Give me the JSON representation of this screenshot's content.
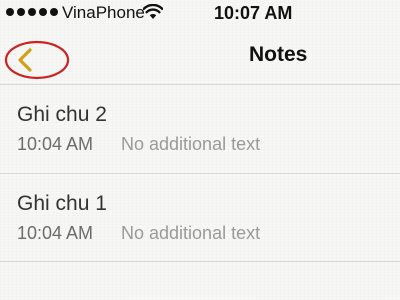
{
  "status_bar": {
    "signal_dots": 5,
    "carrier": "VinaPhone",
    "wifi_icon": "wifi-icon",
    "time": "10:07 AM"
  },
  "nav": {
    "back_icon": "chevron-left-icon",
    "title": "Notes",
    "annotation_color": "#cc2222",
    "accent_color": "#d4a017"
  },
  "notes": [
    {
      "title": "Ghi chu 2",
      "time": "10:04 AM",
      "subtitle": "No additional text"
    },
    {
      "title": "Ghi chu 1",
      "time": "10:04 AM",
      "subtitle": "No additional text"
    }
  ]
}
